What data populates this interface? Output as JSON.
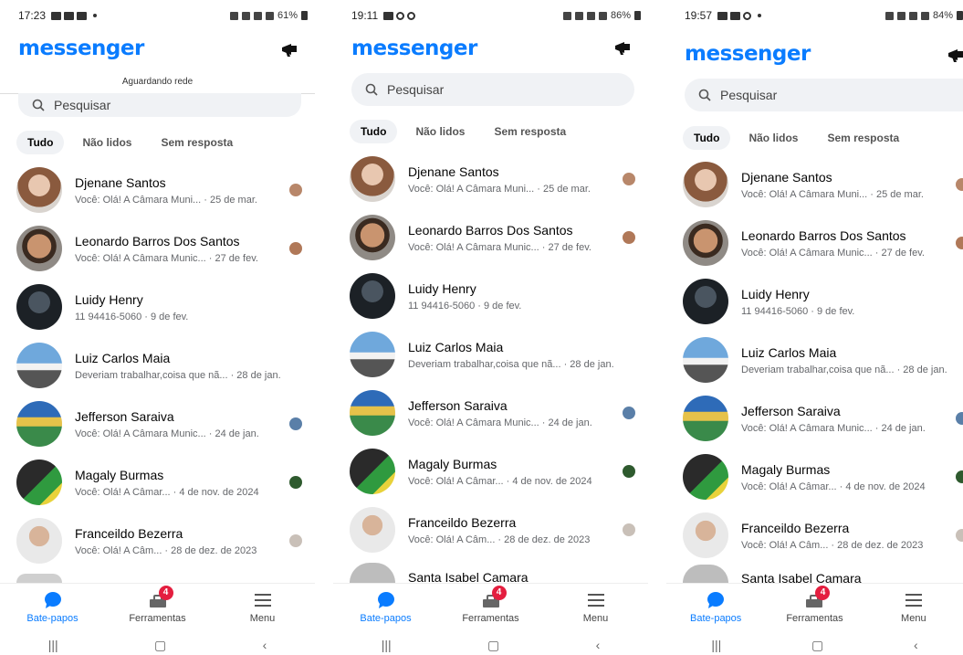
{
  "colors": {
    "accent": "#0a7cff",
    "badge": "#e41e3f"
  },
  "phones": [
    {
      "status_time": "17:23",
      "status_battery": "61%",
      "network_status": "Aguardando rede",
      "search_placeholder": "Pesquisar",
      "tabs": [
        "Tudo",
        "Não lidos",
        "Sem resposta"
      ],
      "conversations": [
        {
          "name": "Djenane Santos",
          "preview": "Você: Olá! A Câmara Muni... · 25 de mar."
        },
        {
          "name": "Leonardo Barros Dos Santos",
          "preview": "Você: Olá! A Câmara Munic... · 27 de fev."
        },
        {
          "name": "Luidy Henry",
          "preview": "11 94416-5060 · 9 de fev."
        },
        {
          "name": "Luiz Carlos Maia",
          "preview": "Deveriam trabalhar,coisa que nã... · 28 de jan."
        },
        {
          "name": "Jefferson Saraiva",
          "preview": "Você: Olá! A Câmara Munic... · 24 de jan."
        },
        {
          "name": "Magaly Burmas",
          "preview": "Você: Olá! A Câmar... · 4 de nov. de 2024"
        },
        {
          "name": "Franceildo Bezerra",
          "preview": "Você: Olá! A Câm... · 28 de dez. de 2023"
        }
      ],
      "nav": {
        "chats": "Bate-papos",
        "tools": "Ferramentas",
        "tools_badge": "4",
        "menu": "Menu"
      }
    },
    {
      "status_time": "19:11",
      "status_battery": "86%",
      "search_placeholder": "Pesquisar",
      "tabs": [
        "Tudo",
        "Não lidos",
        "Sem resposta"
      ],
      "conversations": [
        {
          "name": "Djenane Santos",
          "preview": "Você: Olá! A Câmara Muni... · 25 de mar."
        },
        {
          "name": "Leonardo Barros Dos Santos",
          "preview": "Você: Olá! A Câmara Munic... · 27 de fev."
        },
        {
          "name": "Luidy Henry",
          "preview": "11 94416-5060 · 9 de fev."
        },
        {
          "name": "Luiz Carlos Maia",
          "preview": "Deveriam trabalhar,coisa que nã... · 28 de jan."
        },
        {
          "name": "Jefferson Saraiva",
          "preview": "Você: Olá! A Câmara Munic... · 24 de jan."
        },
        {
          "name": "Magaly Burmas",
          "preview": "Você: Olá! A Câmar... · 4 de nov. de 2024"
        },
        {
          "name": "Franceildo Bezerra",
          "preview": "Você: Olá! A Câm... · 28 de dez. de 2023"
        },
        {
          "name": "Santa Isabel Camara",
          "preview": ""
        }
      ],
      "nav": {
        "chats": "Bate-papos",
        "tools": "Ferramentas",
        "tools_badge": "4",
        "menu": "Menu"
      }
    },
    {
      "status_time": "19:57",
      "status_battery": "84%",
      "search_placeholder": "Pesquisar",
      "tabs": [
        "Tudo",
        "Não lidos",
        "Sem resposta"
      ],
      "conversations": [
        {
          "name": "Djenane Santos",
          "preview": "Você: Olá! A Câmara Muni... · 25 de mar."
        },
        {
          "name": "Leonardo Barros Dos Santos",
          "preview": "Você: Olá! A Câmara Munic... · 27 de fev."
        },
        {
          "name": "Luidy Henry",
          "preview": "11 94416-5060 · 9 de fev."
        },
        {
          "name": "Luiz Carlos Maia",
          "preview": "Deveriam trabalhar,coisa que nã... · 28 de jan."
        },
        {
          "name": "Jefferson Saraiva",
          "preview": "Você: Olá! A Câmara Munic... · 24 de jan."
        },
        {
          "name": "Magaly Burmas",
          "preview": "Você: Olá! A Câmar... · 4 de nov. de 2024"
        },
        {
          "name": "Franceildo Bezerra",
          "preview": "Você: Olá! A Câm... · 28 de dez. de 2023"
        },
        {
          "name": "Santa Isabel Camara",
          "preview": ""
        }
      ],
      "nav": {
        "chats": "Bate-papos",
        "tools": "Ferramentas",
        "tools_badge": "4",
        "menu": "Menu"
      }
    }
  ]
}
